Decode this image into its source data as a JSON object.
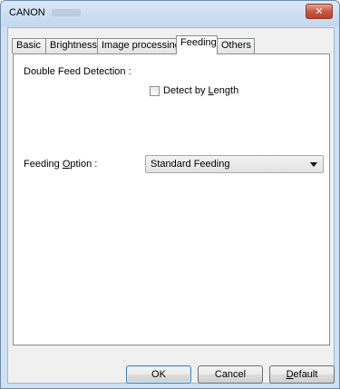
{
  "window": {
    "title": "CANON",
    "close_symbol": "✕"
  },
  "tabs": [
    {
      "label": "Basic",
      "active": false
    },
    {
      "label": "Brightness",
      "active": false
    },
    {
      "label": "Image processing",
      "active": false
    },
    {
      "label": "Feeding",
      "active": true
    },
    {
      "label": "Others",
      "active": false
    }
  ],
  "feeding": {
    "double_feed_label": "Double Feed Detection :",
    "detect_by_length": {
      "label_pre": "Detect by ",
      "label_underlined": "L",
      "label_post": "ength",
      "checked": false
    },
    "feeding_option": {
      "label_pre": "Feeding ",
      "label_underlined": "O",
      "label_post": "ption :",
      "selected": "Standard Feeding"
    }
  },
  "buttons": {
    "ok": "OK",
    "cancel": "Cancel",
    "default_underlined": "D",
    "default_rest": "efault"
  }
}
